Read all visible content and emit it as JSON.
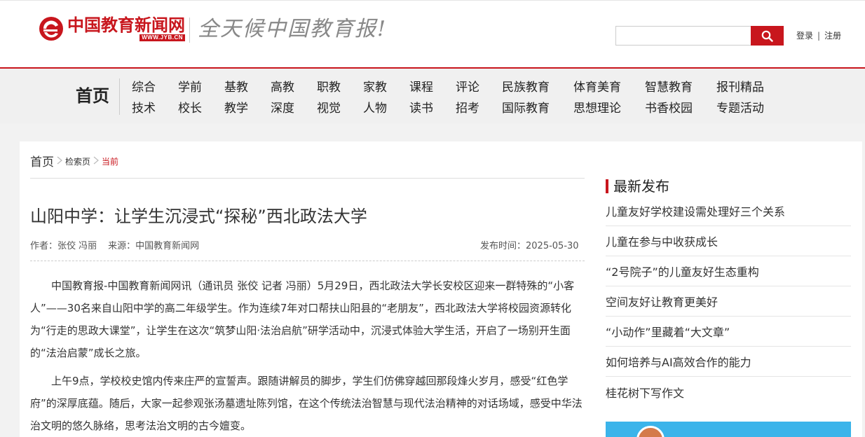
{
  "header": {
    "logo_text": "中国教育新闻网",
    "logo_url": "WWW.JYB.CN",
    "slogan": "全天候中国教育报!",
    "search_placeholder": "",
    "search_value": "",
    "login": "登录",
    "divider": "|",
    "register": "注册"
  },
  "nav": {
    "home": "首页",
    "row1": [
      "综合",
      "学前",
      "基教",
      "高教",
      "职教",
      "家教",
      "课程",
      "评论",
      "民族教育",
      "体育美育",
      "智慧教育",
      "报刊精品"
    ],
    "row2": [
      "技术",
      "校长",
      "教学",
      "深度",
      "视觉",
      "人物",
      "读书",
      "招考",
      "国际教育",
      "思想理论",
      "书香校园",
      "专题活动"
    ]
  },
  "breadcrumb": {
    "home": "首页",
    "search": "检索页",
    "current": "当前"
  },
  "article": {
    "title": "山阳中学：让学生沉浸式“探秘”西北政法大学",
    "author": "作者：张佼 冯丽",
    "source": "来源：中国教育新闻网",
    "publish_time": "发布时间：2025-05-30",
    "paragraphs": [
      "中国教育报-中国教育新闻网讯（通讯员 张佼 记者 冯丽）5月29日，西北政法大学长安校区迎来一群特殊的“小客人”——30名来自山阳中学的高二年级学生。作为连续7年对口帮扶山阳县的“老朋友”，西北政法大学将校园资源转化为“行走的思政大课堂”，让学生在这次“筑梦山阳·法治启航”研学活动中，沉浸式体验大学生活，开启了一场别开生面的“法治启蒙”成长之旅。",
      "上午9点，学校校史馆内传来庄严的宣誓声。跟随讲解员的脚步，学生们仿佛穿越回那段烽火岁月，感受“红色学府”的深厚底蕴。随后，大家一起参观张汤墓遗址陈列馆，在这个传统法治智慧与现代法治精神的对话场域，感受中华法治文明的悠久脉络，思考法治文明的古今嬗变。"
    ]
  },
  "sidebar": {
    "title": "最新发布",
    "items": [
      "儿童友好学校建设需处理好三个关系",
      "儿童在参与中收获成长",
      "“2号院子”的儿童友好生态重构",
      "空间友好让教育更美好",
      "“小动作”里藏着“大文章”",
      "如何培养与AI高效合作的能力",
      "桂花树下写作文"
    ]
  },
  "colors": {
    "brand_red": "#c8161d",
    "banner_blue": "#3bb4ea"
  }
}
